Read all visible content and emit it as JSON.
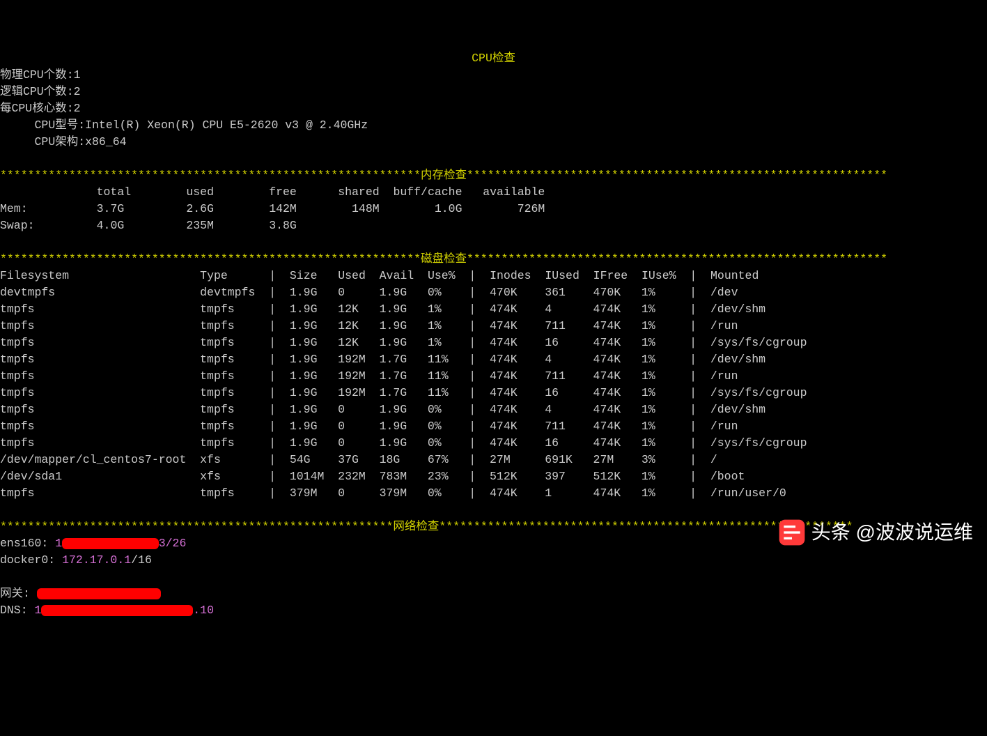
{
  "top_title": "CPU检查",
  "cpu": {
    "phys_label": "物理CPU个数:",
    "phys_val": "1",
    "log_label": "逻辑CPU个数:",
    "log_val": "2",
    "cores_label": "每CPU核心数:",
    "cores_val": "2",
    "model_label": "CPU型号:",
    "model_val": "Intel(R) Xeon(R) CPU E5-2620 v3 @ 2.40GHz",
    "arch_label": "CPU架构:",
    "arch_val": "x86_64"
  },
  "sec_mem": "内存检查",
  "mem_hdr": {
    "total": "total",
    "used": "used",
    "free": "free",
    "shared": "shared",
    "buff": "buff/cache",
    "avail": "available"
  },
  "mem": {
    "label": "Mem:",
    "total": "3.7G",
    "used": "2.6G",
    "free": "142M",
    "shared": "148M",
    "buff": "1.0G",
    "avail": "726M"
  },
  "swap": {
    "label": "Swap:",
    "total": "4.0G",
    "used": "235M",
    "free": "3.8G"
  },
  "sec_disk": "磁盘检查",
  "disk_hdr": {
    "fs": "Filesystem",
    "type": "Type",
    "size": "Size",
    "used": "Used",
    "avail": "Avail",
    "usep": "Use%",
    "inodes": "Inodes",
    "iused": "IUsed",
    "ifree": "IFree",
    "iusep": "IUse%",
    "mount": "Mounted"
  },
  "disk": [
    {
      "fs": "devtmpfs",
      "type": "devtmpfs",
      "size": "1.9G",
      "used": "0",
      "avail": "1.9G",
      "usep": "0%",
      "inodes": "470K",
      "iused": "361",
      "ifree": "470K",
      "iusep": "1%",
      "mount": "/dev"
    },
    {
      "fs": "tmpfs",
      "type": "tmpfs",
      "size": "1.9G",
      "used": "12K",
      "avail": "1.9G",
      "usep": "1%",
      "inodes": "474K",
      "iused": "4",
      "ifree": "474K",
      "iusep": "1%",
      "mount": "/dev/shm"
    },
    {
      "fs": "tmpfs",
      "type": "tmpfs",
      "size": "1.9G",
      "used": "12K",
      "avail": "1.9G",
      "usep": "1%",
      "inodes": "474K",
      "iused": "711",
      "ifree": "474K",
      "iusep": "1%",
      "mount": "/run"
    },
    {
      "fs": "tmpfs",
      "type": "tmpfs",
      "size": "1.9G",
      "used": "12K",
      "avail": "1.9G",
      "usep": "1%",
      "inodes": "474K",
      "iused": "16",
      "ifree": "474K",
      "iusep": "1%",
      "mount": "/sys/fs/cgroup"
    },
    {
      "fs": "tmpfs",
      "type": "tmpfs",
      "size": "1.9G",
      "used": "192M",
      "avail": "1.7G",
      "usep": "11%",
      "inodes": "474K",
      "iused": "4",
      "ifree": "474K",
      "iusep": "1%",
      "mount": "/dev/shm"
    },
    {
      "fs": "tmpfs",
      "type": "tmpfs",
      "size": "1.9G",
      "used": "192M",
      "avail": "1.7G",
      "usep": "11%",
      "inodes": "474K",
      "iused": "711",
      "ifree": "474K",
      "iusep": "1%",
      "mount": "/run"
    },
    {
      "fs": "tmpfs",
      "type": "tmpfs",
      "size": "1.9G",
      "used": "192M",
      "avail": "1.7G",
      "usep": "11%",
      "inodes": "474K",
      "iused": "16",
      "ifree": "474K",
      "iusep": "1%",
      "mount": "/sys/fs/cgroup"
    },
    {
      "fs": "tmpfs",
      "type": "tmpfs",
      "size": "1.9G",
      "used": "0",
      "avail": "1.9G",
      "usep": "0%",
      "inodes": "474K",
      "iused": "4",
      "ifree": "474K",
      "iusep": "1%",
      "mount": "/dev/shm"
    },
    {
      "fs": "tmpfs",
      "type": "tmpfs",
      "size": "1.9G",
      "used": "0",
      "avail": "1.9G",
      "usep": "0%",
      "inodes": "474K",
      "iused": "711",
      "ifree": "474K",
      "iusep": "1%",
      "mount": "/run"
    },
    {
      "fs": "tmpfs",
      "type": "tmpfs",
      "size": "1.9G",
      "used": "0",
      "avail": "1.9G",
      "usep": "0%",
      "inodes": "474K",
      "iused": "16",
      "ifree": "474K",
      "iusep": "1%",
      "mount": "/sys/fs/cgroup"
    },
    {
      "fs": "/dev/mapper/cl_centos7-root",
      "type": "xfs",
      "size": "54G",
      "used": "37G",
      "avail": "18G",
      "usep": "67%",
      "inodes": "27M",
      "iused": "691K",
      "ifree": "27M",
      "iusep": "3%",
      "mount": "/"
    },
    {
      "fs": "/dev/sda1",
      "type": "xfs",
      "size": "1014M",
      "used": "232M",
      "avail": "783M",
      "usep": "23%",
      "inodes": "512K",
      "iused": "397",
      "ifree": "512K",
      "iusep": "1%",
      "mount": "/boot"
    },
    {
      "fs": "tmpfs",
      "type": "tmpfs",
      "size": "379M",
      "used": "0",
      "avail": "379M",
      "usep": "0%",
      "inodes": "474K",
      "iused": "1",
      "ifree": "474K",
      "iusep": "1%",
      "mount": "/run/user/0"
    }
  ],
  "sec_net": "网络检查",
  "net": {
    "if1_label": "ens160: ",
    "if1_pre": "1",
    "if1_suf": "3/26",
    "if2_label": "docker0: ",
    "if2_ip": "172.17.0.1",
    "if2_suf": "/16",
    "gw_label": "网关: ",
    "dns_label": "DNS: ",
    "dns_pre": "1",
    "dns_suf": ".10"
  },
  "watermark": "头条 @波波说运维"
}
